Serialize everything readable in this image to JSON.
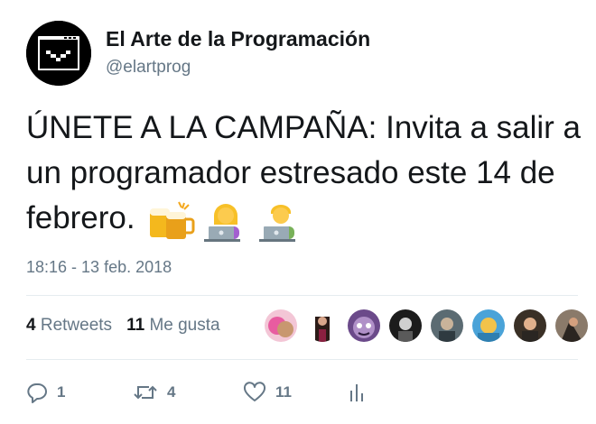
{
  "author": {
    "display_name": "El Arte de la Programación",
    "handle": "@elartprog",
    "avatar_icon": "terminal-window-icon"
  },
  "tweet": {
    "text": "ÚNETE A LA CAMPAÑA: Invita a salir a un programador estresado este 14 de febrero.",
    "emojis": [
      "beer-mugs-icon",
      "woman-technologist-icon",
      "man-technologist-icon"
    ],
    "timestamp": "18:16 - 13 feb. 2018"
  },
  "stats": {
    "retweets_count": "4",
    "retweets_label": "Retweets",
    "likes_count": "11",
    "likes_label": "Me gusta"
  },
  "likers": [
    "liker-avatar",
    "liker-avatar",
    "liker-avatar",
    "liker-avatar",
    "liker-avatar",
    "liker-avatar",
    "liker-avatar",
    "liker-avatar"
  ],
  "actions": {
    "reply_count": "1",
    "retweet_count": "4",
    "like_count": "11"
  },
  "colors": {
    "text": "#14171a",
    "secondary": "#657786",
    "divider": "#e6ecf0"
  }
}
